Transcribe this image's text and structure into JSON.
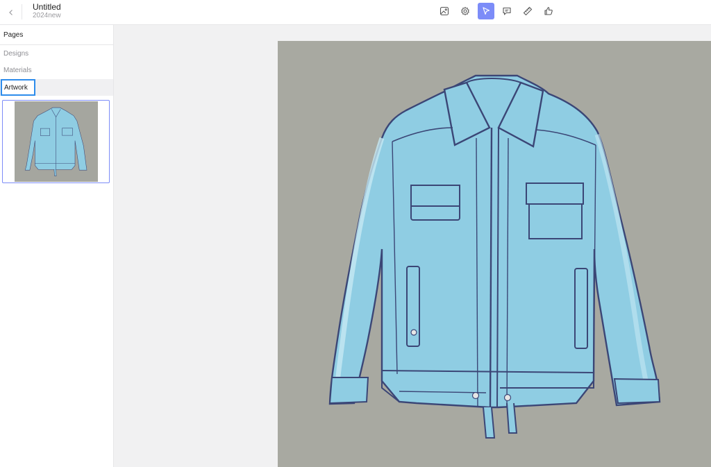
{
  "header": {
    "title": "Untitled",
    "subtitle": "2024new"
  },
  "toolbar": {
    "tools": [
      {
        "icon": "image-icon",
        "active": false
      },
      {
        "icon": "settings-gear-icon",
        "active": false
      },
      {
        "icon": "cursor-pointer-icon",
        "active": true
      },
      {
        "icon": "comment-icon",
        "active": false
      },
      {
        "icon": "ruler-icon",
        "active": false
      },
      {
        "icon": "thumbs-up-icon",
        "active": false
      }
    ],
    "active_color": "#7c8cf8"
  },
  "sidebar": {
    "header": "Pages",
    "items": [
      {
        "label": "Designs"
      },
      {
        "label": "Materials"
      },
      {
        "label": "Artwork",
        "selected": true
      }
    ]
  },
  "canvas": {
    "background": "#f1f1f2",
    "artwork_background": "#a8a9a1",
    "jacket_color": "#8fcde3"
  }
}
